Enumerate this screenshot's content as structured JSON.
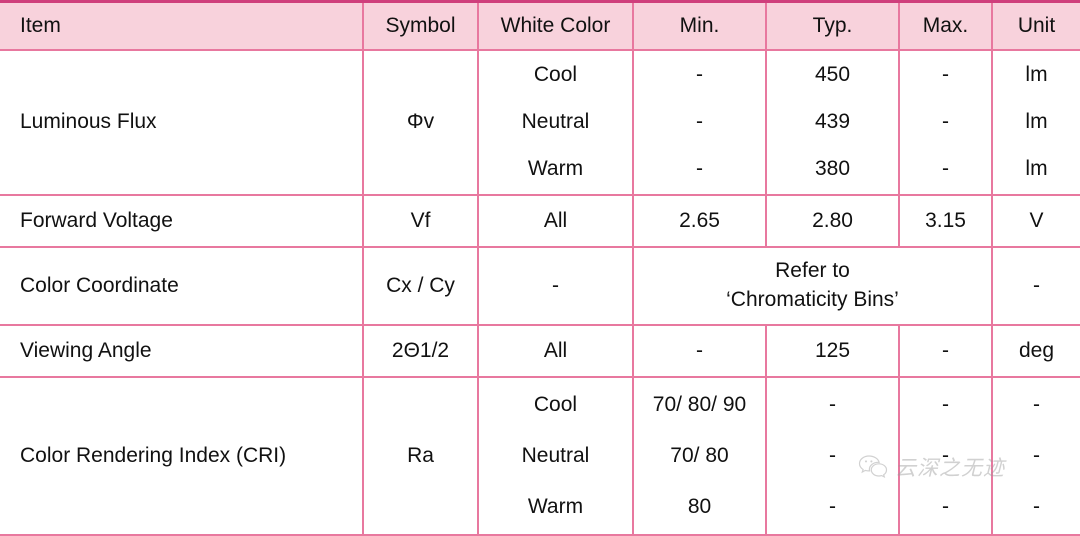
{
  "table": {
    "columns": [
      {
        "key": "item",
        "label": "Item"
      },
      {
        "key": "symbol",
        "label": "Symbol"
      },
      {
        "key": "white",
        "label": "White Color"
      },
      {
        "key": "min",
        "label": "Min."
      },
      {
        "key": "typ",
        "label": "Typ."
      },
      {
        "key": "max",
        "label": "Max."
      },
      {
        "key": "unit",
        "label": "Unit"
      }
    ],
    "rows": [
      {
        "item": "Luminous Flux",
        "symbol": "Φv",
        "sub": [
          {
            "white": "Cool",
            "min": "-",
            "typ": "450",
            "max": "-",
            "unit": "lm"
          },
          {
            "white": "Neutral",
            "min": "-",
            "typ": "439",
            "max": "-",
            "unit": "lm"
          },
          {
            "white": "Warm",
            "min": "-",
            "typ": "380",
            "max": "-",
            "unit": "lm"
          }
        ]
      },
      {
        "item": "Forward Voltage",
        "symbol": "Vf",
        "white": "All",
        "min": "2.65",
        "typ": "2.80",
        "max": "3.15",
        "unit": "V"
      },
      {
        "item": "Color Coordinate",
        "symbol": "Cx / Cy",
        "white": "-",
        "merged_line1": "Refer to",
        "merged_line2": "‘Chromaticity Bins’",
        "unit": "-"
      },
      {
        "item": "Viewing Angle",
        "symbol": "2Θ1/2",
        "white": "All",
        "min": "-",
        "typ": "125",
        "max": "-",
        "unit": "deg"
      },
      {
        "item": "Color Rendering Index (CRI)",
        "symbol": "Ra",
        "sub": [
          {
            "white": "Cool",
            "min": "70/ 80/ 90",
            "typ": "-",
            "max": "-",
            "unit": "-"
          },
          {
            "white": "Neutral",
            "min": "70/ 80",
            "typ": "-",
            "max": "-",
            "unit": "-"
          },
          {
            "white": "Warm",
            "min": "80",
            "typ": "-",
            "max": "-",
            "unit": "-"
          }
        ]
      }
    ]
  },
  "watermark": {
    "text": "云深之无迹",
    "icon": "wechat-icon"
  },
  "colors": {
    "header_background": "#f8d2dc",
    "header_top_border": "#cf3f7c",
    "grid_line": "#e8789f",
    "text": "#111111"
  }
}
